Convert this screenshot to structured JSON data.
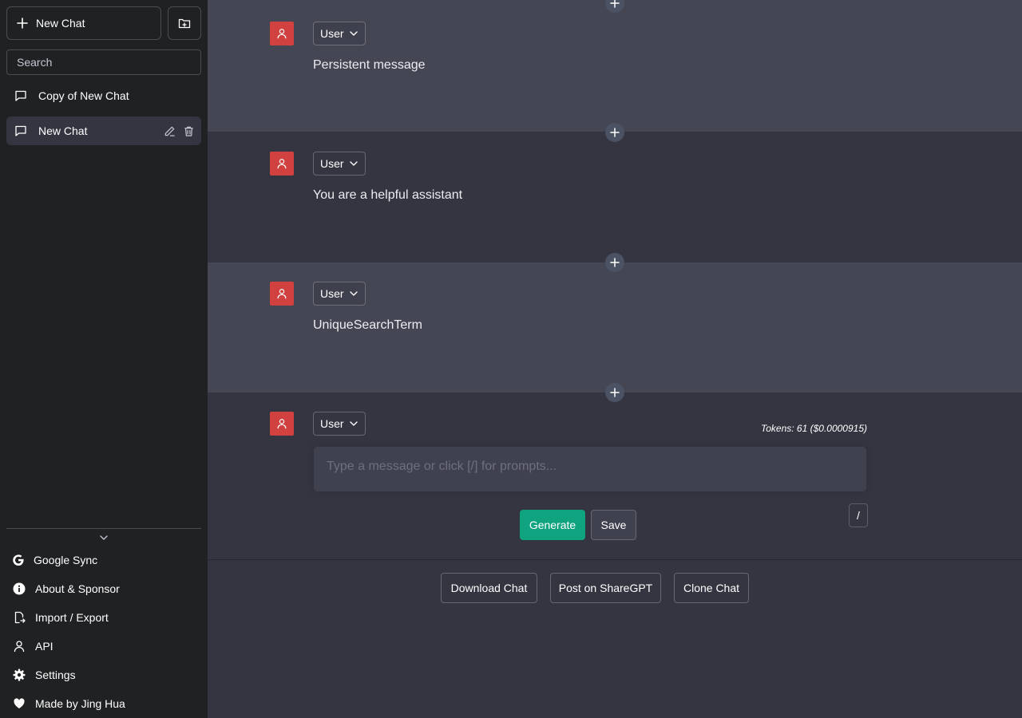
{
  "sidebar": {
    "new_chat_label": "New Chat",
    "search_placeholder": "Search",
    "chats": [
      {
        "title": "Copy of New Chat",
        "active": false
      },
      {
        "title": "New Chat",
        "active": true
      }
    ],
    "menu": [
      {
        "label": "Google Sync",
        "icon": "google-icon"
      },
      {
        "label": "About & Sponsor",
        "icon": "info-icon"
      },
      {
        "label": "Import / Export",
        "icon": "import-export-icon"
      },
      {
        "label": "API",
        "icon": "person-icon"
      },
      {
        "label": "Settings",
        "icon": "gear-icon"
      },
      {
        "label": "Made by Jing Hua",
        "icon": "heart-icon"
      }
    ]
  },
  "messages": [
    {
      "role": "User",
      "content": "Persistent message"
    },
    {
      "role": "User",
      "content": "You are a helpful assistant"
    },
    {
      "role": "User",
      "content": "UniqueSearchTerm"
    }
  ],
  "composer": {
    "role": "User",
    "tokens": "Tokens: 61 ($0.0000915)",
    "placeholder": "Type a message or click [/] for prompts...",
    "generate_label": "Generate",
    "save_label": "Save",
    "slash_label": "/"
  },
  "bottom_actions": {
    "download_label": "Download Chat",
    "share_label": "Post on ShareGPT",
    "clone_label": "Clone Chat"
  },
  "colors": {
    "sidebar_bg": "#202123",
    "main_bg": "#343541",
    "message_alt_bg": "#444654",
    "avatar_bg": "#d0413f",
    "accent_green": "#10a37f"
  }
}
